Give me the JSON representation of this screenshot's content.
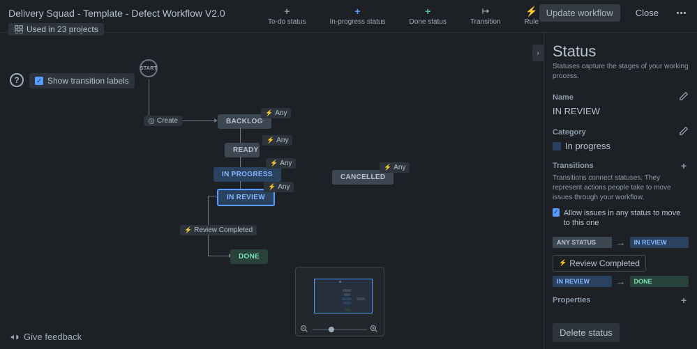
{
  "header": {
    "breadcrumb": "Delivery Squad - Template - Defect Workflow V2.0",
    "usage_tag": "Used in 23 projects",
    "update_btn": "Update workflow",
    "close_btn": "Close"
  },
  "toolbar": {
    "todo": "To-do status",
    "inprogress": "In-progress status",
    "done": "Done status",
    "transition": "Transition",
    "rule": "Rule"
  },
  "controls": {
    "show_labels": "Show transition labels"
  },
  "nodes": {
    "start": "START",
    "backlog": "BACKLOG",
    "ready": "READY",
    "in_progress": "IN PROGRESS",
    "in_review": "IN REVIEW",
    "cancelled": "CANCELLED",
    "done": "DONE"
  },
  "transitions": {
    "create": "Create",
    "any": "Any",
    "review_completed": "Review Completed"
  },
  "panel": {
    "title": "Status",
    "desc": "Statuses capture the stages of your working process.",
    "name_label": "Name",
    "name_value": "IN REVIEW",
    "category_label": "Category",
    "category_value": "In progress",
    "transitions_label": "Transitions",
    "transitions_desc": "Transitions connect statuses. They represent actions people take to move issues through your workflow.",
    "allow_label": "Allow issues in any status to move to this one",
    "trans1_from": "ANY STATUS",
    "trans1_to": "IN REVIEW",
    "review_completed": "Review Completed",
    "trans2_from": "IN REVIEW",
    "trans2_to": "DONE",
    "properties_label": "Properties",
    "delete_btn": "Delete status"
  },
  "feedback": "Give feedback"
}
